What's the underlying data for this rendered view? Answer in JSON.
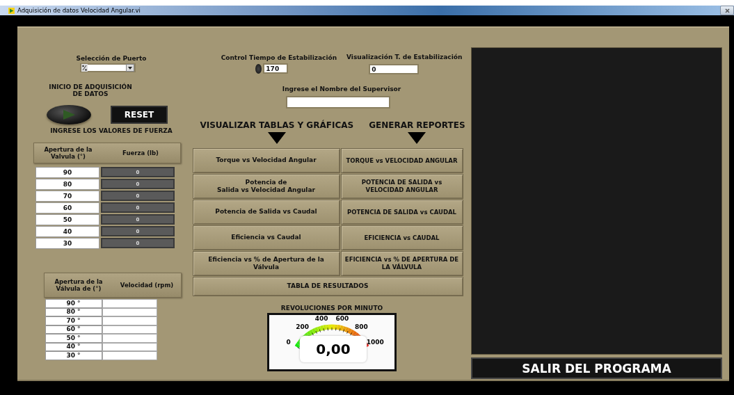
{
  "window": {
    "title": "Adquisición de datos Velocidad Angular.vi"
  },
  "port": {
    "label": "Selección de Puerto"
  },
  "start": {
    "label": "INICIO DE ADQUISICIÓN DE DATOS",
    "on": false
  },
  "reset_button": "RESET",
  "force_prompt": "INGRESE LOS VALORES DE FUERZA",
  "force_table": {
    "columns": [
      "Apertura de la Valvula  (°)",
      "Fuerza (lb)"
    ],
    "rows": [
      {
        "angle": "90",
        "force": "0"
      },
      {
        "angle": "80",
        "force": "0"
      },
      {
        "angle": "70",
        "force": "0"
      },
      {
        "angle": "60",
        "force": "0"
      },
      {
        "angle": "50",
        "force": "0"
      },
      {
        "angle": "40",
        "force": "0"
      },
      {
        "angle": "30",
        "force": "0"
      }
    ]
  },
  "speed_table": {
    "columns": [
      "Apertura de la Válvula de  (°)",
      "Velocidad (rpm)"
    ],
    "rows": [
      {
        "angle": "90  °"
      },
      {
        "angle": "80  °"
      },
      {
        "angle": "70  °"
      },
      {
        "angle": "60  °"
      },
      {
        "angle": "50  °"
      },
      {
        "angle": "40  °"
      },
      {
        "angle": "30  °"
      }
    ]
  },
  "stabilization_control": {
    "label": "Control Tiempo de Estabilización",
    "value": "170"
  },
  "stabilization_display": {
    "label": "Visualización  T. de Estabilización",
    "value": "0"
  },
  "supervisor": {
    "label": "Ingrese el Nombre del Supervisor"
  },
  "graphs_heading": "VISUALIZAR TABLAS Y GRÁFICAS",
  "reports_heading": "GENERAR REPORTES",
  "graph_buttons": [
    "Torque vs Velocidad Angular",
    "Potencia de\nSalida vs Velocidad Angular",
    "Potencia de Salida vs Caudal",
    "Eficiencia vs Caudal",
    "Eficiencia  vs % de Apertura de la Válvula"
  ],
  "report_buttons": [
    "TORQUE vs VELOCIDAD ANGULAR",
    "POTENCIA DE SALIDA vs  VELOCIDAD ANGULAR",
    "POTENCIA DE SALIDA vs CAUDAL",
    "EFICIENCIA vs CAUDAL",
    "EFICIENCIA vs % DE APERTURA DE LA VÁLVULA"
  ],
  "results_button": "TABLA DE RESULTADOS",
  "gauge": {
    "title": "REVOLUCIONES POR MINUTO",
    "tick_labels": [
      "0",
      "200",
      "400",
      "600",
      "800",
      "1000"
    ],
    "reading": "0,00"
  },
  "exit_button": "SALIR DEL PROGRAMA"
}
